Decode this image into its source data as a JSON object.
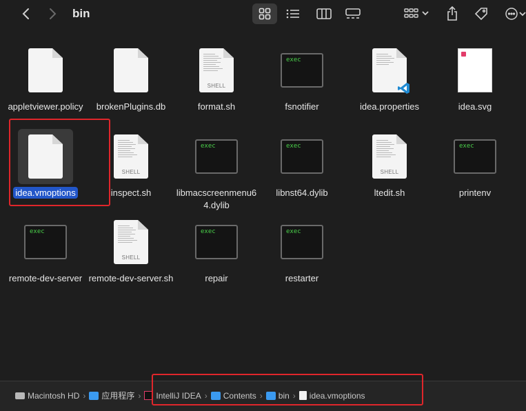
{
  "window": {
    "title": "bin"
  },
  "toolbar": {
    "back_icon": "chevron-left-icon",
    "forward_icon": "chevron-right-icon",
    "views": [
      "icon-view",
      "list-view",
      "column-view",
      "gallery-view"
    ],
    "group_icon": "group-by-icon",
    "share_icon": "share-icon",
    "tag_icon": "tag-icon",
    "more_icon": "more-icon"
  },
  "files": [
    {
      "name": "appletviewer.policy",
      "kind": "doc"
    },
    {
      "name": "brokenPlugins.db",
      "kind": "doc"
    },
    {
      "name": "format.sh",
      "kind": "shell",
      "badge": "SHELL"
    },
    {
      "name": "fsnotifier",
      "kind": "exec",
      "badge": "exec"
    },
    {
      "name": "idea.properties",
      "kind": "props"
    },
    {
      "name": "idea.svg",
      "kind": "svg"
    },
    {
      "name": "idea.vmoptions",
      "kind": "doc",
      "selected": true
    },
    {
      "name": "inspect.sh",
      "kind": "shell",
      "badge": "SHELL"
    },
    {
      "name": "libmacscreenmenu64.dylib",
      "kind": "exec",
      "badge": "exec"
    },
    {
      "name": "libnst64.dylib",
      "kind": "exec",
      "badge": "exec"
    },
    {
      "name": "ltedit.sh",
      "kind": "shell",
      "badge": "SHELL"
    },
    {
      "name": "printenv",
      "kind": "exec",
      "badge": "exec"
    },
    {
      "name": "remote-dev-server",
      "kind": "exec",
      "badge": "exec"
    },
    {
      "name": "remote-dev-server.sh",
      "kind": "shell",
      "badge": "SHELL"
    },
    {
      "name": "repair",
      "kind": "exec",
      "badge": "exec"
    },
    {
      "name": "restarter",
      "kind": "exec",
      "badge": "exec"
    }
  ],
  "pathbar": {
    "items": [
      {
        "label": "Macintosh HD",
        "icon": "disk-icon"
      },
      {
        "label": "应用程序",
        "icon": "folder-icon"
      },
      {
        "label": "IntelliJ IDEA",
        "icon": "app-icon"
      },
      {
        "label": "Contents",
        "icon": "folder-icon"
      },
      {
        "label": "bin",
        "icon": "folder-icon"
      },
      {
        "label": "idea.vmoptions",
        "icon": "file-icon"
      }
    ],
    "separator": "›"
  },
  "colors": {
    "highlight": "#e0262b",
    "selection": "#2256c9",
    "exec_text": "#4ad04a"
  }
}
